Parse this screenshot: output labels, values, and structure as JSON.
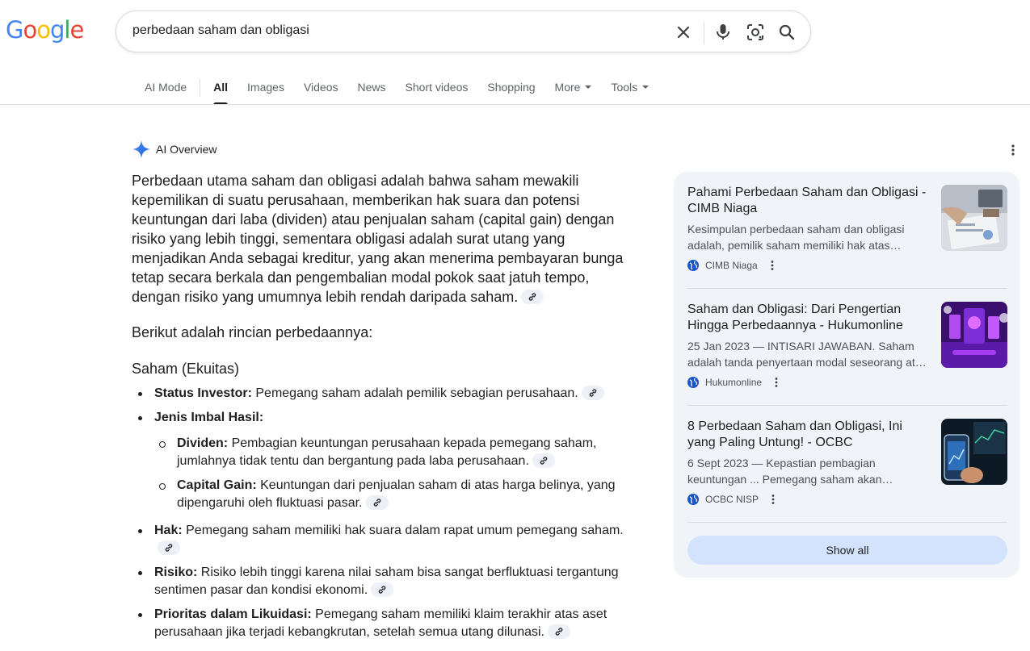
{
  "logo": {
    "letters": [
      "G",
      "o",
      "o",
      "g",
      "l",
      "e"
    ],
    "colors": [
      "#4285F4",
      "#EA4335",
      "#FBBC05",
      "#4285F4",
      "#34A853",
      "#EA4335"
    ]
  },
  "search": {
    "query": "perbedaan saham dan obligasi"
  },
  "tabs": [
    {
      "label": "AI Mode"
    },
    {
      "label": "All",
      "active": true
    },
    {
      "label": "Images"
    },
    {
      "label": "Videos"
    },
    {
      "label": "News"
    },
    {
      "label": "Short videos"
    },
    {
      "label": "Shopping"
    },
    {
      "label": "More"
    },
    {
      "label": "Tools"
    }
  ],
  "ai_overview": {
    "label": "AI Overview",
    "paragraph1": "Perbedaan utama saham dan obligasi adalah bahwa saham mewakili kepemilikan di suatu perusahaan, memberikan hak suara dan potensi keuntungan dari laba (dividen) atau penjualan saham (capital gain) dengan risiko yang lebih tinggi, sementara obligasi adalah surat utang yang menjadikan Anda sebagai kreditur, yang akan menerima pembayaran bunga tetap secara berkala dan pengembalian modal pokok saat jatuh tempo, dengan risiko yang umumnya lebih rendah daripada saham.",
    "paragraph2": "Berikut adalah rincian perbedaannya:",
    "subheading": "Saham (Ekuitas)",
    "bullets": {
      "status": {
        "term": "Status Investor:",
        "text": " Pemegang saham adalah pemilik sebagian perusahaan."
      },
      "jenis": {
        "term": "Jenis Imbal Hasil:"
      },
      "dividen": {
        "term": "Dividen:",
        "text": " Pembagian keuntungan perusahaan kepada pemegang saham, jumlahnya tidak tentu dan bergantung pada laba perusahaan."
      },
      "capital": {
        "term": "Capital Gain:",
        "text": " Keuntungan dari penjualan saham di atas harga belinya, yang dipengaruhi oleh fluktuasi pasar."
      },
      "hak": {
        "term": "Hak:",
        "text": " Pemegang saham memiliki hak suara dalam rapat umum pemegang saham."
      },
      "risiko": {
        "term": "Risiko:",
        "text": " Risiko lebih tinggi karena nilai saham bisa sangat berfluktuasi tergantung sentimen pasar dan kondisi ekonomi."
      },
      "prioritas": {
        "term": "Prioritas dalam Likuidasi:",
        "text": " Pemegang saham memiliki klaim terakhir atas aset perusahaan jika terjadi kebangkrutan, setelah semua utang dilunasi."
      }
    }
  },
  "sources": [
    {
      "title": "Pahami Perbedaan Saham dan Obligasi - CIMB Niaga",
      "snippet": "Kesimpulan perbedaan saham dan obligasi adalah, pemilik saham memiliki hak atas…",
      "source": "CIMB Niaga"
    },
    {
      "title": "Saham dan Obligasi: Dari Pengertian Hingga Perbedaannya - Hukumonline",
      "snippet": "25 Jan 2023 — INTISARI JAWABAN. Saham adalah tanda penyertaan modal seseorang at…",
      "source": "Hukumonline"
    },
    {
      "title": "8 Perbedaan Saham dan Obligasi, Ini yang Paling Untung! - OCBC",
      "snippet": "6 Sept 2023 — Kepastian pembagian keuntungan ... Pemegang saham akan…",
      "source": "OCBC NISP"
    }
  ],
  "show_all": "Show all"
}
